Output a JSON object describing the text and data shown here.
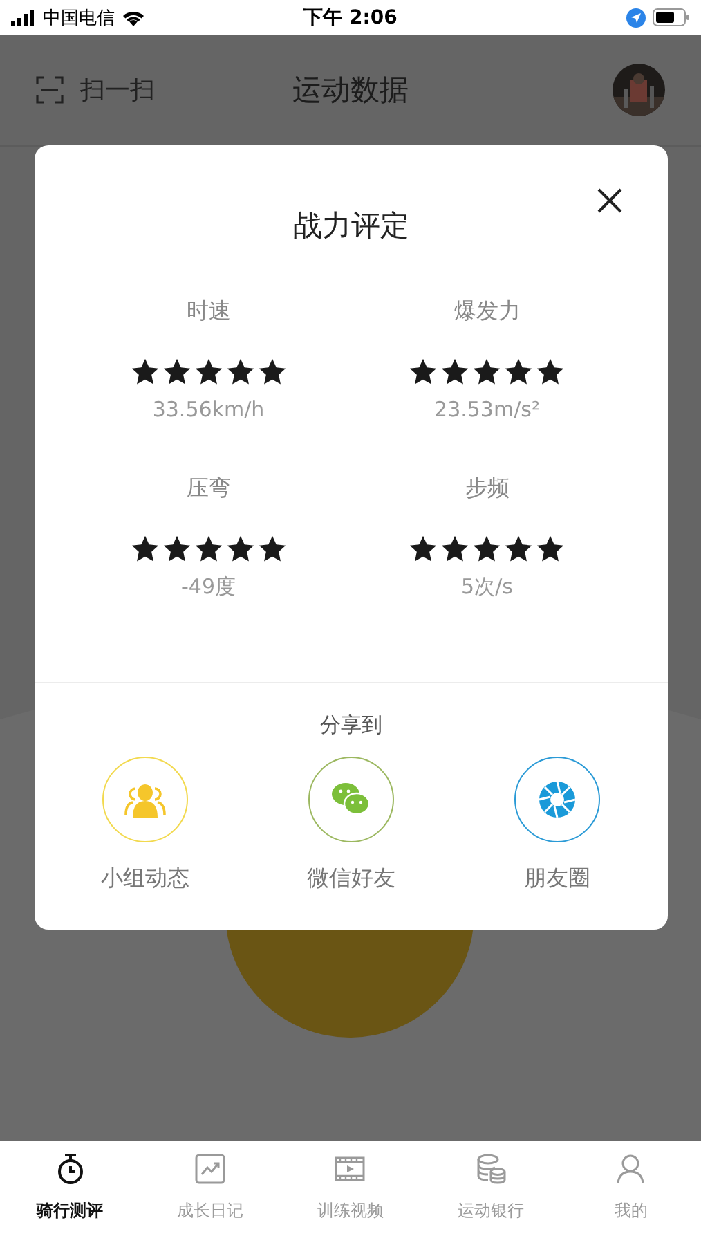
{
  "status_bar": {
    "carrier": "中国电信",
    "time": "下午 2:06"
  },
  "header": {
    "scan_label": "扫一扫",
    "title": "运动数据"
  },
  "dialog": {
    "title": "战力评定",
    "ratings": [
      {
        "label": "时速",
        "stars": 5,
        "value": "33.56km/h"
      },
      {
        "label": "爆发力",
        "stars": 5,
        "value": "23.53m/s²"
      },
      {
        "label": "压弯",
        "stars": 5,
        "value": "-49度"
      },
      {
        "label": "步频",
        "stars": 5,
        "value": "5次/s"
      }
    ],
    "share": {
      "title": "分享到",
      "targets": [
        {
          "kind": "group",
          "label": "小组动态",
          "color": "#f2d94e"
        },
        {
          "kind": "wechat",
          "label": "微信好友",
          "color": "#9cb860"
        },
        {
          "kind": "moments",
          "label": "朋友圈",
          "color": "#2a9ad6"
        }
      ]
    }
  },
  "tab_bar": [
    {
      "kind": "stopwatch",
      "label": "骑行测评",
      "selected": true
    },
    {
      "kind": "chart",
      "label": "成长日记",
      "selected": false
    },
    {
      "kind": "film",
      "label": "训练视频",
      "selected": false
    },
    {
      "kind": "coins",
      "label": "运动银行",
      "selected": false
    },
    {
      "kind": "person",
      "label": "我的",
      "selected": false
    }
  ]
}
